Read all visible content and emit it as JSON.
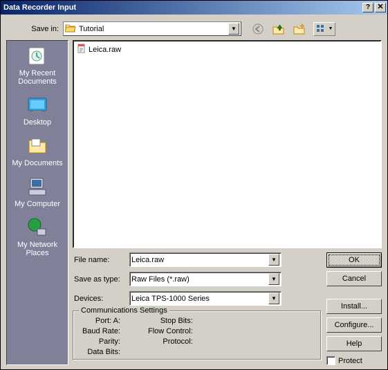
{
  "window": {
    "title": "Data Recorder Input"
  },
  "save_in": {
    "label": "Save in:",
    "value": "Tutorial"
  },
  "places": [
    {
      "label": "My Recent Documents"
    },
    {
      "label": "Desktop"
    },
    {
      "label": "My Documents"
    },
    {
      "label": "My Computer"
    },
    {
      "label": "My Network Places"
    }
  ],
  "files": [
    {
      "name": "Leica.raw"
    }
  ],
  "file_name": {
    "label": "File name:",
    "value": "Leica.raw"
  },
  "save_as_type": {
    "label": "Save as type:",
    "value": "Raw Files (*.raw)"
  },
  "devices": {
    "label": "Devices:",
    "value": "Leica TPS-1000 Series"
  },
  "comm": {
    "title": "Communications Settings",
    "port": "Port: A:",
    "baud": "Baud Rate:",
    "parity": "Parity:",
    "databits": "Data Bits:",
    "stopbits": "Stop Bits:",
    "flow": "Flow Control:",
    "protocol": "Protocol:"
  },
  "buttons": {
    "ok": "OK",
    "cancel": "Cancel",
    "install": "Install...",
    "configure": "Configure...",
    "help": "Help"
  },
  "protect": {
    "label": "Protect"
  }
}
